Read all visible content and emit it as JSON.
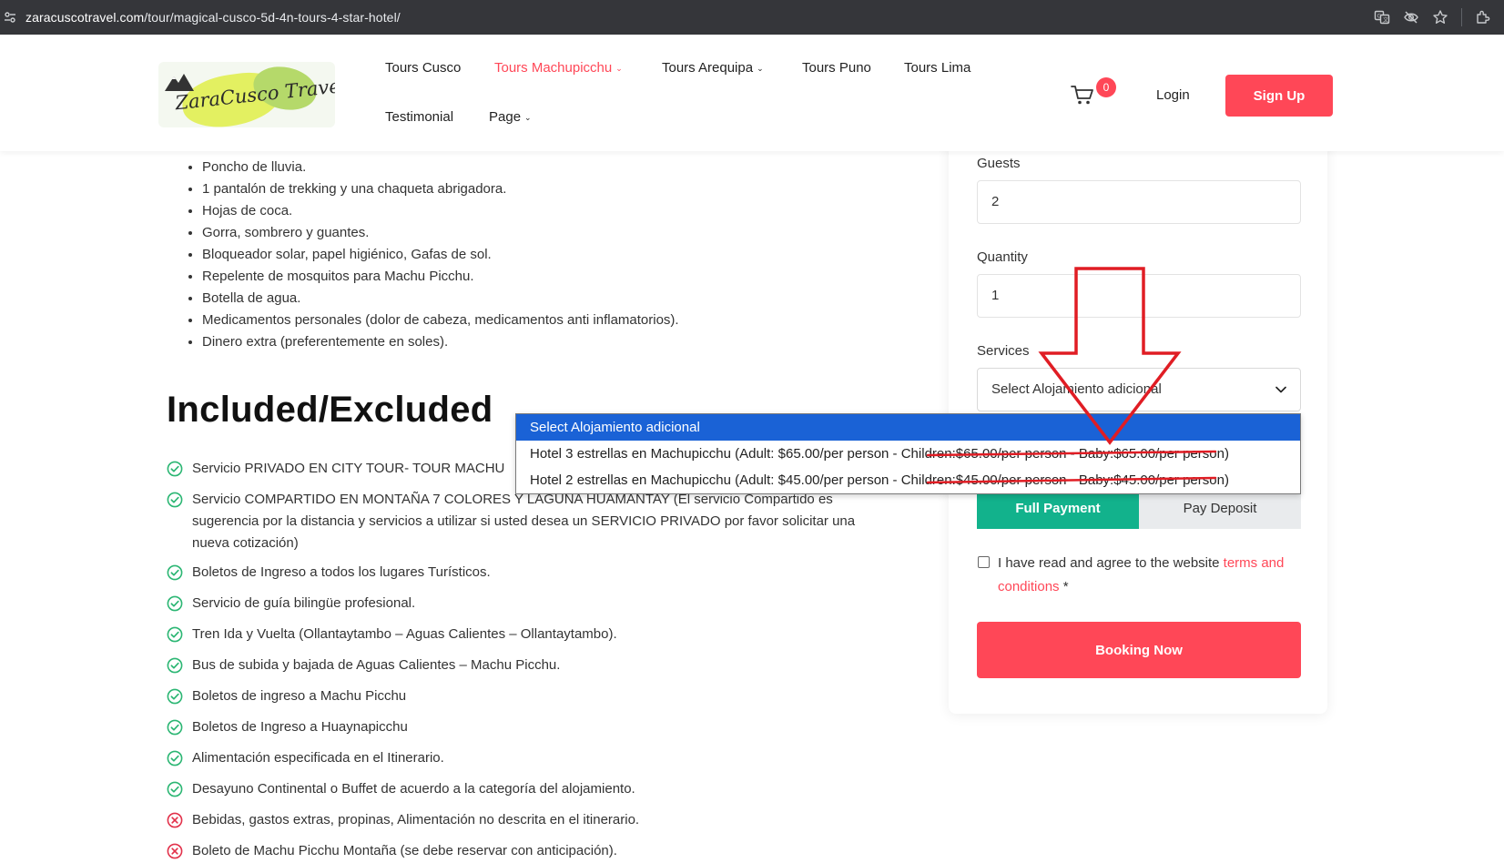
{
  "browser": {
    "url_host": "zaracuscotravel.com",
    "url_path": "/tour/magical-cusco-5d-4n-tours-4-star-hotel/"
  },
  "header": {
    "logo_text": "ZaraCusco Travel",
    "nav": [
      {
        "label": "Tours Cusco",
        "dropdown": false,
        "active": false
      },
      {
        "label": "Tours Machupicchu",
        "dropdown": true,
        "active": true
      },
      {
        "label": "Tours Arequipa",
        "dropdown": true,
        "active": false
      },
      {
        "label": "Tours Puno",
        "dropdown": false,
        "active": false
      },
      {
        "label": "Tours Lima",
        "dropdown": false,
        "active": false
      },
      {
        "label": "Testimonial",
        "dropdown": false,
        "active": false
      },
      {
        "label": "Page",
        "dropdown": true,
        "active": false
      }
    ],
    "cart_count": "0",
    "login_label": "Login",
    "signup_label": "Sign Up"
  },
  "what_to_bring": [
    "Poncho de lluvia.",
    "1 pantalón de trekking y una chaqueta abrigadora.",
    "Hojas de coca.",
    "Gorra, sombrero y guantes.",
    "Bloqueador solar, papel higiénico, Gafas de sol.",
    "Repelente de mosquitos para Machu Picchu.",
    "Botella de agua.",
    "Medicamentos personales (dolor de cabeza, medicamentos anti inflamatorios).",
    "Dinero extra (preferentemente en soles)."
  ],
  "included_excluded": {
    "title": "Included/Excluded",
    "items": [
      {
        "text": "Servicio PRIVADO EN CITY TOUR- TOUR MACHU",
        "included": true
      },
      {
        "text": "Servicio COMPARTIDO EN MONTAÑA 7 COLORES Y LAGUNA HUAMANTAY (El servicio Compartido es sugerencia por la distancia y servicios a utilizar si usted desea un SERVICIO PRIVADO por favor solicitar una nueva cotización)",
        "included": true
      },
      {
        "text": "Boletos de Ingreso a todos los lugares Turísticos.",
        "included": true
      },
      {
        "text": "Servicio de guía bilingüe profesional.",
        "included": true
      },
      {
        "text": "Tren Ida y Vuelta (Ollantaytambo – Aguas Calientes – Ollantaytambo).",
        "included": true
      },
      {
        "text": "Bus de subida y bajada de Aguas Calientes – Machu Picchu.",
        "included": true
      },
      {
        "text": "Boletos de ingreso a Machu Picchu",
        "included": true
      },
      {
        "text": "Boletos de Ingreso a Huaynapicchu",
        "included": true
      },
      {
        "text": "Alimentación especificada en el Itinerario.",
        "included": true
      },
      {
        "text": "Desayuno Continental o Buffet de acuerdo a la categoría del alojamiento.",
        "included": true
      },
      {
        "text": "Bebidas, gastos extras, propinas, Alimentación no descrita en el itinerario.",
        "included": false
      },
      {
        "text": "Boleto de Machu Picchu Montaña (se debe reservar con anticipación).",
        "included": false
      }
    ]
  },
  "booking": {
    "guests_label": "Guests",
    "guests_value": "2",
    "quantity_label": "Quantity",
    "quantity_value": "1",
    "services_label": "Services",
    "services_selected": "Select Alojamiento adicional",
    "services_options": [
      "Select Alojamiento adicional",
      "Hotel 3 estrellas en Machupicchu (Adult: $65.00/per person - Children:$65.00/per person - Baby:$65.00/per person)",
      "Hotel 2 estrellas en Machupicchu (Adult: $45.00/per person - Children:$45.00/per person - Baby:$45.00/per person)"
    ],
    "full_payment_label": "Full Payment",
    "pay_deposit_label": "Pay Deposit",
    "terms_prefix": "I have read and agree to the website ",
    "terms_link": "terms and conditions",
    "terms_suffix": " *",
    "booking_label": "Booking Now"
  },
  "colors": {
    "accent": "#ff4757",
    "payment_active": "#12b28c",
    "check_green": "#2bb673",
    "cross_red": "#e2314a",
    "dropdown_selected": "#1a62d6",
    "annotation_red": "#e01d24"
  }
}
